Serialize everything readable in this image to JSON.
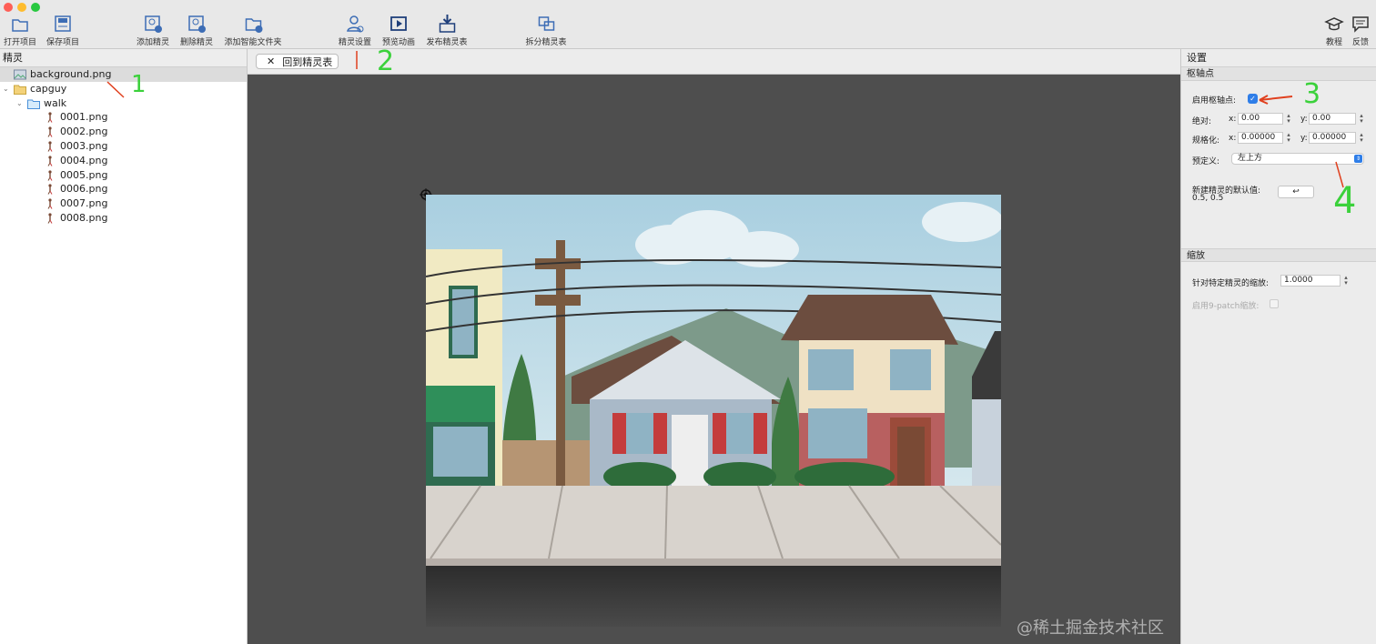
{
  "toolbar": {
    "buttons": [
      {
        "label": "打开项目",
        "icon": "folder-open-icon"
      },
      {
        "label": "保存项目",
        "icon": "save-icon"
      },
      {
        "label": "添加精灵",
        "icon": "add-sprite-icon"
      },
      {
        "label": "删除精灵",
        "icon": "delete-sprite-icon"
      },
      {
        "label": "添加智能文件夹",
        "icon": "add-smart-folder-icon"
      },
      {
        "label": "精灵设置",
        "icon": "sprite-settings-icon"
      },
      {
        "label": "预览动画",
        "icon": "preview-animation-icon"
      },
      {
        "label": "发布精灵表",
        "icon": "publish-sheet-icon"
      },
      {
        "label": "拆分精灵表",
        "icon": "split-sheet-icon"
      },
      {
        "label": "教程",
        "icon": "tutorial-icon"
      },
      {
        "label": "反馈",
        "icon": "feedback-icon"
      }
    ]
  },
  "sprites_panel": {
    "title": "精灵",
    "items": [
      {
        "label": "background.png",
        "kind": "image"
      },
      {
        "label": "capguy",
        "kind": "folder"
      },
      {
        "label": "walk",
        "kind": "folder"
      },
      {
        "label": "0001.png",
        "kind": "sprite"
      },
      {
        "label": "0002.png",
        "kind": "sprite"
      },
      {
        "label": "0003.png",
        "kind": "sprite"
      },
      {
        "label": "0004.png",
        "kind": "sprite"
      },
      {
        "label": "0005.png",
        "kind": "sprite"
      },
      {
        "label": "0006.png",
        "kind": "sprite"
      },
      {
        "label": "0007.png",
        "kind": "sprite"
      },
      {
        "label": "0008.png",
        "kind": "sprite"
      }
    ]
  },
  "center": {
    "back_tab_label": "回到精灵表",
    "close_glyph": "✕"
  },
  "settings": {
    "title": "设置",
    "pivot_section": "枢轴点",
    "enable_pivot_label": "启用枢轴点:",
    "enable_pivot_checked": true,
    "absolute_label": "绝对:",
    "abs_x_label": "x:",
    "abs_x_value": "0.00",
    "abs_y_label": "y:",
    "abs_y_value": "0.00",
    "normalized_label": "规格化:",
    "norm_x_label": "x:",
    "norm_x_value": "0.00000",
    "norm_y_label": "y:",
    "norm_y_value": "0.00000",
    "preset_label": "预定义:",
    "preset_value": "左上方",
    "default_label": "新建精灵的默认值:",
    "default_value": "0.5, 0.5",
    "apply_glyph": "↩",
    "scale_section": "缩放",
    "scale_label": "针对特定精灵的缩放:",
    "scale_value": "1.0000",
    "ninepatch_label": "启用9-patch缩放:"
  },
  "annotations": [
    "1",
    "2",
    "3",
    "4"
  ],
  "watermark": "@稀土掘金技术社区",
  "colors": {
    "annotation_red": "#e0401e",
    "annotation_green": "#3bd13b",
    "accent_blue": "#2f7ee8"
  }
}
